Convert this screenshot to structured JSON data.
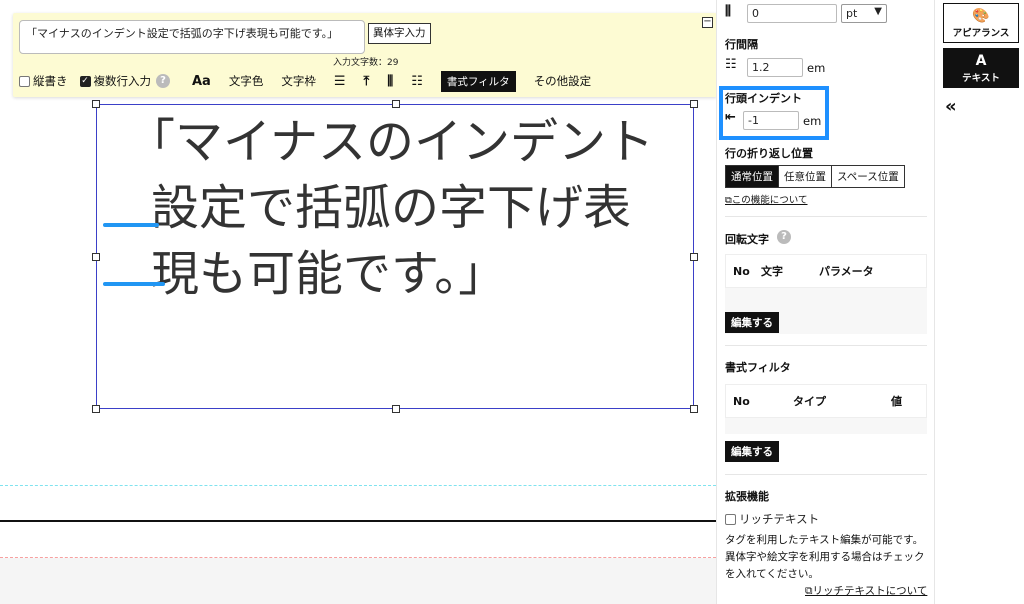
{
  "toolbar": {
    "text_value": "「マイナスのインデント設定で括弧の字下げ表現も可能です。」",
    "itaiji_label": "異体字入力",
    "collapse_symbol": "−",
    "char_count": "入力文字数：29",
    "vertical_label": "縦書き",
    "vertical_checked": false,
    "multiline_label": "複数行入力",
    "multiline_checked": true,
    "help_symbol": "?",
    "font_icon": "Aa",
    "text_color_label": "文字色",
    "text_border_label": "文字枠",
    "filter_label": "書式フィルタ",
    "other_label": "その他設定"
  },
  "canvas": {
    "line1": "「マイナスのインデント",
    "line2": "設定で括弧の字下げ表",
    "line3": "現も可能です。」"
  },
  "props": {
    "spacing_value": "0",
    "spacing_unit": "pt",
    "line_spacing_label": "行間隔",
    "line_spacing_value": "1.2",
    "line_spacing_unit": "em",
    "indent_label": "行頭インデント",
    "indent_value": "-1",
    "indent_unit": "em",
    "wrap_label": "行の折り返し位置",
    "wrap_options": [
      "通常位置",
      "任意位置",
      "スペース位置"
    ],
    "wrap_active": 0,
    "wrap_link": "この機能について",
    "rotate_label": "回転文字",
    "rotate_cols": [
      "No",
      "文字",
      "パラメータ"
    ],
    "edit_label": "編集する",
    "filter_label": "書式フィルタ",
    "filter_cols": [
      "No",
      "タイプ",
      "値"
    ],
    "ext_label": "拡張機能",
    "rich_label": "リッチテキスト",
    "rich_desc": "タグを利用したテキスト編集が可能です。異体字や絵文字を利用する場合はチェックを入れてください。",
    "rich_link": "リッチテキストについて"
  },
  "side": {
    "appearance_label": "アピアランス",
    "text_label": "テキスト",
    "collapse_symbol": "«"
  },
  "colors": {
    "highlight": "#1e90ff",
    "frame": "#3b40c8",
    "toolbar_bg": "#fdfbd3"
  }
}
